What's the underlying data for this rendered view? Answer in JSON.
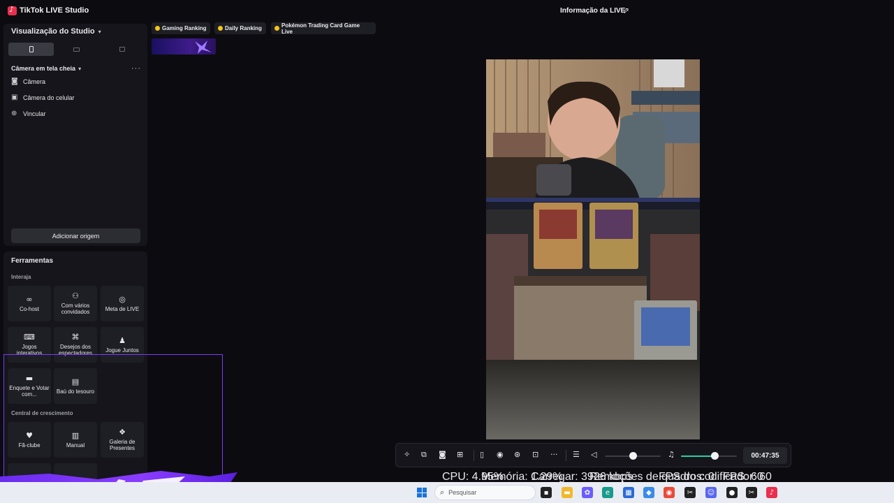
{
  "titlebar": {
    "app_title": "TikTok LIVE Studio",
    "live_info": "Informação da LIVE"
  },
  "studio": {
    "heading": "Visualização do Studio",
    "scene_title": "Câmera em tela cheia",
    "sources": [
      {
        "label": "Câmera",
        "icon": "camera-icon"
      },
      {
        "label": "Câmera do celular",
        "icon": "phone-camera-icon"
      },
      {
        "label": "Vincular",
        "icon": "globe-icon"
      }
    ],
    "add_source": "Adicionar origem"
  },
  "tools": {
    "title": "Ferramentas",
    "interact_heading": "Interaja",
    "interact": [
      {
        "label": "Co-host",
        "icon": "link-icon"
      },
      {
        "label": "Com vários convidados",
        "icon": "users-icon"
      },
      {
        "label": "Meta de LIVE",
        "icon": "target-icon"
      },
      {
        "label": "Jogos interativos",
        "icon": "gamepad-icon"
      },
      {
        "label": "Desejos dos espectadores",
        "icon": "gift-icon"
      },
      {
        "label": "Jogue Juntos",
        "icon": "player-icon"
      },
      {
        "label": "Enquete e Votar com...",
        "icon": "poll-icon"
      },
      {
        "label": "Baú do tesouro",
        "icon": "chest-icon"
      }
    ],
    "growth_heading": "Central de crescimento",
    "growth": [
      {
        "label": "Fã-clube",
        "icon": "heart-icon"
      },
      {
        "label": "Manual",
        "icon": "book-icon"
      },
      {
        "label": "Galeria de Presentes",
        "icon": "gallery-icon"
      }
    ]
  },
  "rankings": [
    {
      "label": "Gaming Ranking"
    },
    {
      "label": "Daily Ranking"
    },
    {
      "label": "Pokémon Trading Card Game Live"
    }
  ],
  "controls": {
    "timer": "00:47:35",
    "volume_level": 0.5,
    "mic_level": 0.6,
    "accent": "#25d0a8"
  },
  "stats": {
    "cpu": "CPU: 4.95%",
    "memory": "Memória: 1.29%",
    "upload": "Carregar: 3926 kbps",
    "dropped": "Remoções de quadros: 0",
    "encoder_fps": "FPS do codificador: 60",
    "fps": "FPS: 60"
  },
  "taskbar": {
    "search_placeholder": "Pesquisar"
  }
}
